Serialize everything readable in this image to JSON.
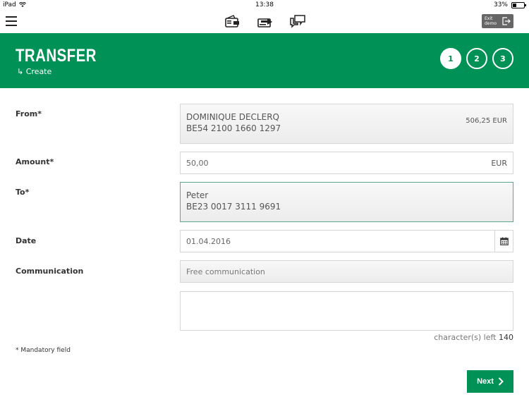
{
  "status_bar": {
    "device": "iPad",
    "time": "13:38",
    "battery_percent": "33%",
    "battery_level": 0.33
  },
  "top_nav": {
    "icons": [
      "hamburger-menu-icon",
      "wallet-icon",
      "transfer-icon",
      "messages-icon"
    ],
    "exit_label_1": "Exit",
    "exit_label_2": "demo"
  },
  "header": {
    "title": "TRANSFER",
    "subtitle": "↳ Create",
    "steps": [
      "1",
      "2",
      "3"
    ],
    "active_step": 1,
    "color": "#009156"
  },
  "form": {
    "from": {
      "label": "From*",
      "name": "DOMINIQUE DECLERQ",
      "account": "BE54 2100 1660 1297",
      "balance": "506,25 EUR"
    },
    "amount": {
      "label": "Amount*",
      "value": "50,00",
      "currency": "EUR"
    },
    "to": {
      "label": "To*",
      "name": "Peter",
      "account": "BE23 0017 3111 9691"
    },
    "date": {
      "label": "Date",
      "value": "01.04.2016"
    },
    "communication": {
      "label": "Communication",
      "placeholder": "Free communication",
      "free_text_value": ""
    },
    "chars_left_label": "character(s) left",
    "chars_left_value": "140",
    "mandatory_note": "* Mandatory field",
    "next_label": "Next"
  }
}
